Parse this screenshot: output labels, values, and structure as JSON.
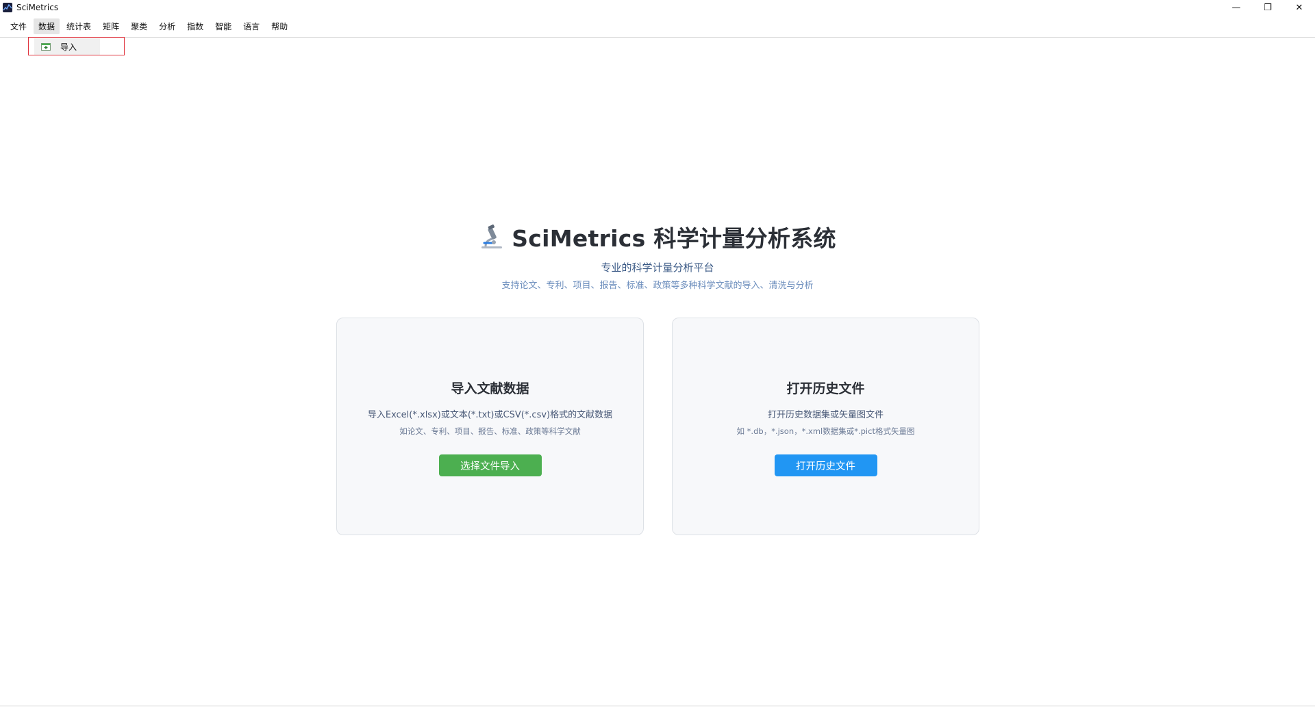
{
  "window": {
    "title": "SciMetrics",
    "controls": {
      "minimize": "—",
      "restore": "❐",
      "close": "✕"
    }
  },
  "menu": {
    "items": [
      "文件",
      "数据",
      "统计表",
      "矩阵",
      "聚类",
      "分析",
      "指数",
      "智能",
      "语言",
      "帮助"
    ],
    "active_index": 1
  },
  "dropdown": {
    "items": [
      {
        "label": "导入",
        "icon": "import-icon"
      }
    ]
  },
  "hero": {
    "icon": "microscope-icon",
    "title": "SciMetrics 科学计量分析系统",
    "subtitle": "专业的科学计量分析平台",
    "description": "支持论文、专利、项目、报告、标准、政策等多种科学文献的导入、清洗与分析"
  },
  "cards": {
    "import": {
      "title": "导入文献数据",
      "description": "导入Excel(*.xlsx)或文本(*.txt)或CSV(*.csv)格式的文献数据",
      "note": "如论文、专利、项目、报告、标准、政策等科学文献",
      "button": "选择文件导入",
      "button_color": "#4caf50"
    },
    "history": {
      "title": "打开历史文件",
      "description": "打开历史数据集或矢量图文件",
      "note": "如 *.db，*.json，*.xml数据集或*.pict格式矢量图",
      "button": "打开历史文件",
      "button_color": "#2196f3"
    }
  },
  "colors": {
    "highlight": "#e0353f",
    "title_text": "#2b2f36",
    "subtitle_text": "#3b5a86"
  }
}
